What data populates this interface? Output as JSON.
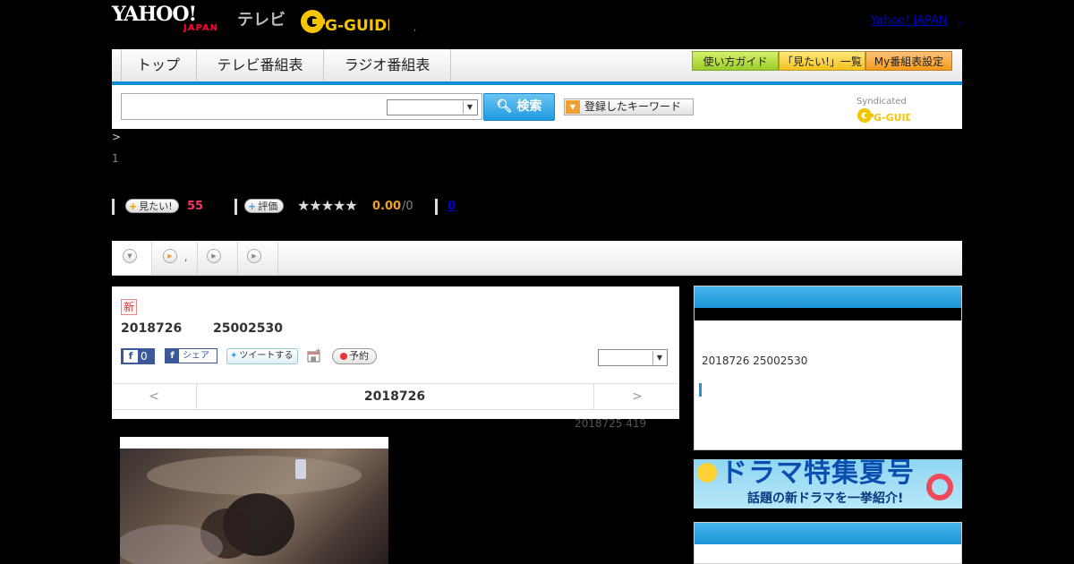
{
  "header": {
    "yahoo_logo": "YAHOO!",
    "japan_logo": "JAPAN",
    "tv_logo": "テレビ",
    "gguide_logo": "G-GUIDE",
    "dot": ",",
    "link_yahoo_japan": "Yahoo! JAPAN",
    "link_extra": ","
  },
  "nav": {
    "tabs": [
      {
        "label": "トップ"
      },
      {
        "label": "テレビ番組表"
      },
      {
        "label": "ラジオ番組表"
      }
    ],
    "buttons": [
      {
        "label": "使い方ガイド"
      },
      {
        "label": "「見たい!」一覧"
      },
      {
        "label": "My番組表設定"
      }
    ]
  },
  "search": {
    "input_value": "",
    "button_label": "検索",
    "keyword_label": "登録したキーワード",
    "syndicated": "Syndicated"
  },
  "meta": {
    "breadcrumb_sep": ">",
    "breadcrumb_num": "1",
    "want_label": "見たい!",
    "want_count": "55",
    "rate_label": "評価",
    "stars": "★★★★★",
    "rating": "0.00",
    "rating_max": "/0",
    "comments": "0"
  },
  "tabs_row": {
    "tab2_text": ","
  },
  "program": {
    "new_badge": "新",
    "date": "2018726",
    "time": "25002530",
    "fb_count": "0",
    "share_label": "シェア",
    "tweet_label": "ツイートする",
    "reserve_label": "予約",
    "pager_prev": "<",
    "pager_date": "2018726",
    "pager_next": ">",
    "below_info": "2018725  419"
  },
  "sidebar": {
    "info_text": "2018726  25002530",
    "banner_title": "ドラマ特集夏号",
    "banner_sub": "話題の新ドラマを一挙紹介!"
  },
  "colors": {
    "accent_blue": "#1c94d6",
    "want_pink": "#ff3366",
    "rating_orange": "#f0a030"
  }
}
